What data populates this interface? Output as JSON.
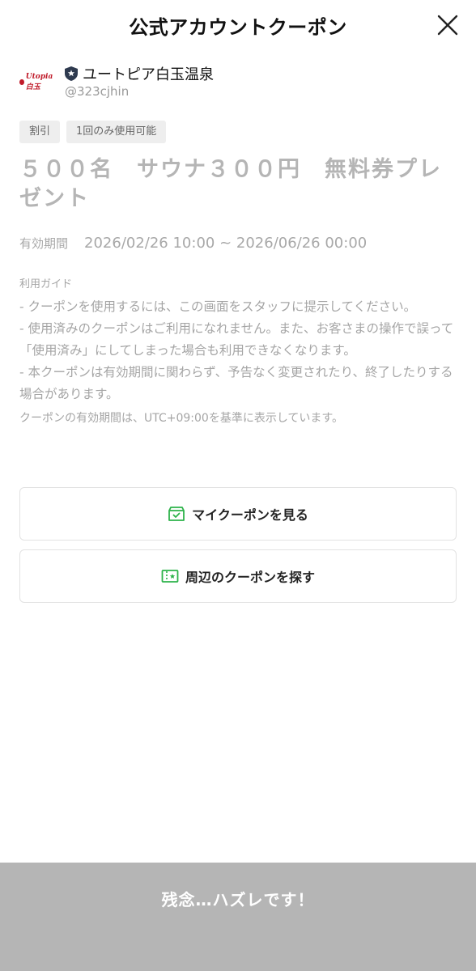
{
  "header": {
    "title": "公式アカウントクーポン",
    "close_icon": "close-icon"
  },
  "account": {
    "logo_text": "Utopia白玉",
    "name": "ユートピア白玉温泉",
    "id": "@323cjhin",
    "badge_icon": "shield-star-icon"
  },
  "tags": [
    "割引",
    "1回のみ使用可能"
  ],
  "coupon": {
    "title": "５００名　サウナ３００円　無料券プレゼント",
    "validity_label": "有効期間",
    "validity_range": "2026/02/26 10:00 ~ 2026/06/26 00:00"
  },
  "guide": {
    "heading": "利用ガイド",
    "lines": [
      "- クーポンを使用するには、この画面をスタッフに提示してください。",
      "- 使用済みのクーポンはご利用になれません。また、お客さまの操作で誤って「使用済み」にしてしまった場合も利用できなくなります。",
      "- 本クーポンは有効期間に関わらず、予告なく変更されたり、終了したりする場合があります。"
    ],
    "timezone_note": "クーポンの有効期間は、UTC+09:00を基準に表示しています。"
  },
  "actions": {
    "my_coupons": "マイクーポンを見る",
    "nearby_coupons": "周辺のクーポンを探す"
  },
  "bottom": {
    "result": "残念…ハズレです！"
  },
  "colors": {
    "accent_green": "#2db34a",
    "muted_text": "#a8a8a8",
    "bottom_bar": "#b5b5b5"
  }
}
